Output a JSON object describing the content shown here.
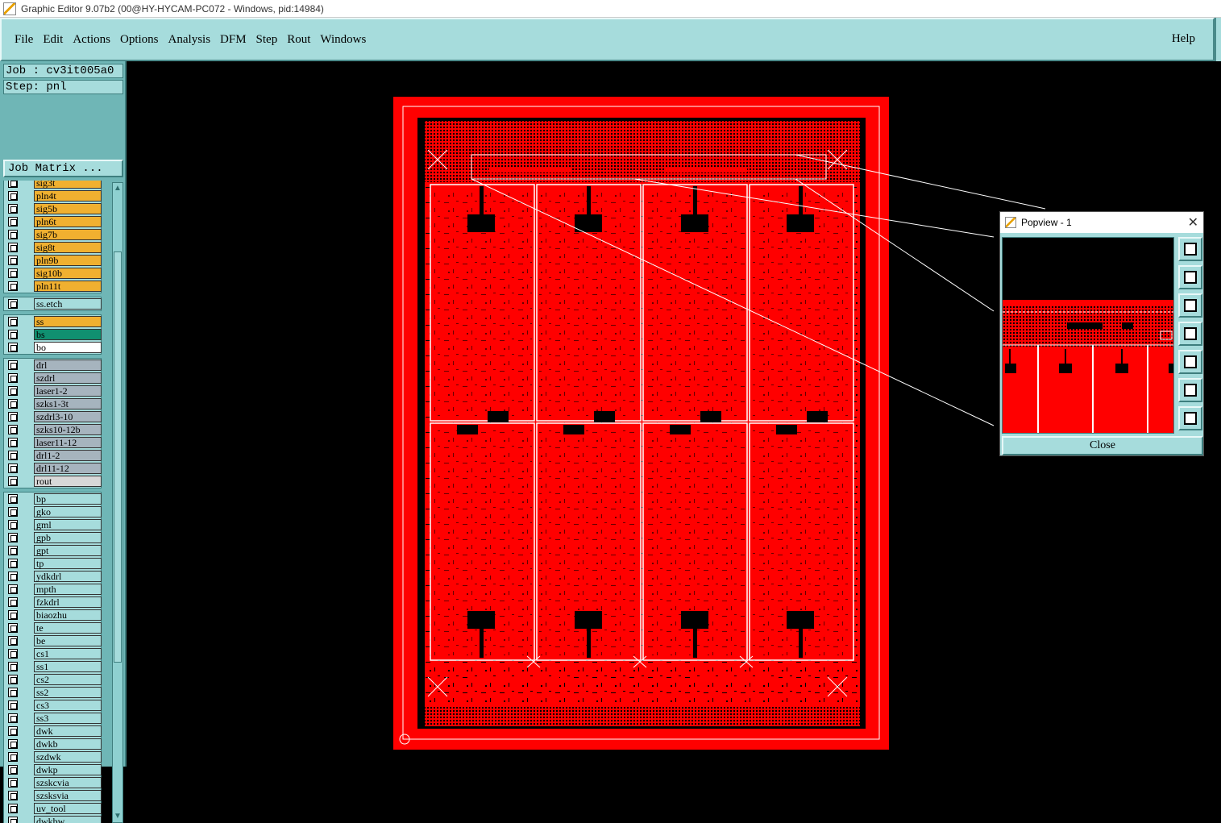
{
  "window": {
    "title": "Graphic Editor 9.07b2 (00@HY-HYCAM-PC072 - Windows, pid:14984)"
  },
  "menu": {
    "items": [
      "File",
      "Edit",
      "Actions",
      "Options",
      "Analysis",
      "DFM",
      "Step",
      "Rout",
      "Windows"
    ],
    "help": "Help"
  },
  "sidebar": {
    "job": "Job : cv3it005a0",
    "step": "Step: pnl",
    "job_matrix": "Job Matrix ...",
    "groups": [
      {
        "layers": [
          {
            "name": "sig3t",
            "color": "#f0b030"
          },
          {
            "name": "pln4t",
            "color": "#f0b030"
          },
          {
            "name": "sig5b",
            "color": "#f0b030"
          },
          {
            "name": "pln6t",
            "color": "#f0b030"
          },
          {
            "name": "sig7b",
            "color": "#f0b030"
          },
          {
            "name": "sig8t",
            "color": "#f0b030"
          },
          {
            "name": "pln9b",
            "color": "#f0b030"
          },
          {
            "name": "sig10b",
            "color": "#f0b030"
          },
          {
            "name": "pln11t",
            "color": "#f0b030"
          }
        ]
      },
      {
        "layers": [
          {
            "name": "ss.etch",
            "color": "#a6dcdc"
          }
        ]
      },
      {
        "layers": [
          {
            "name": "ss",
            "color": "#f0b030"
          },
          {
            "name": "bs",
            "color": "#109070"
          },
          {
            "name": "bo",
            "color": "#ffffff"
          }
        ]
      },
      {
        "layers": [
          {
            "name": "drl",
            "color": "#a6b4be"
          },
          {
            "name": "szdrl",
            "color": "#a6b4be"
          },
          {
            "name": "laser1-2",
            "color": "#a6b4be"
          },
          {
            "name": "szks1-3t",
            "color": "#a6b4be"
          },
          {
            "name": "szdrl3-10",
            "color": "#a6b4be"
          },
          {
            "name": "szks10-12b",
            "color": "#a6b4be"
          },
          {
            "name": "laser11-12",
            "color": "#a6b4be"
          },
          {
            "name": "drl1-2",
            "color": "#a6b4be"
          },
          {
            "name": "drl11-12",
            "color": "#a6b4be"
          },
          {
            "name": "rout",
            "color": "#d8d8d8"
          }
        ]
      },
      {
        "layers": [
          {
            "name": "bp",
            "color": "#a6dcdc"
          },
          {
            "name": "gko",
            "color": "#a6dcdc"
          },
          {
            "name": "gml",
            "color": "#a6dcdc"
          },
          {
            "name": "gpb",
            "color": "#a6dcdc"
          },
          {
            "name": "gpt",
            "color": "#a6dcdc"
          },
          {
            "name": "tp",
            "color": "#a6dcdc"
          },
          {
            "name": "ydkdrl",
            "color": "#a6dcdc"
          },
          {
            "name": "mpth",
            "color": "#a6dcdc"
          },
          {
            "name": "fzkdrl",
            "color": "#a6dcdc"
          },
          {
            "name": "biaozhu",
            "color": "#a6dcdc"
          },
          {
            "name": "te",
            "color": "#a6dcdc"
          },
          {
            "name": "be",
            "color": "#a6dcdc"
          },
          {
            "name": "cs1",
            "color": "#a6dcdc"
          },
          {
            "name": "ss1",
            "color": "#a6dcdc"
          },
          {
            "name": "cs2",
            "color": "#a6dcdc"
          },
          {
            "name": "ss2",
            "color": "#a6dcdc"
          },
          {
            "name": "cs3",
            "color": "#a6dcdc"
          },
          {
            "name": "ss3",
            "color": "#a6dcdc"
          },
          {
            "name": "dwk",
            "color": "#a6dcdc"
          },
          {
            "name": "dwkb",
            "color": "#a6dcdc"
          },
          {
            "name": "szdwk",
            "color": "#a6dcdc"
          },
          {
            "name": "dwkp",
            "color": "#a6dcdc"
          },
          {
            "name": "szskcvia",
            "color": "#a6dcdc"
          },
          {
            "name": "szsksvia",
            "color": "#a6dcdc"
          },
          {
            "name": "uv_tool",
            "color": "#a6dcdc"
          },
          {
            "name": "dwkbw",
            "color": "#a6dcdc"
          }
        ]
      }
    ]
  },
  "popview": {
    "title": "Popview - 1",
    "close_label": "Close",
    "tools": [
      "zoom-home-icon",
      "pan-up-icon",
      "pan-down-icon",
      "pan-left-icon",
      "pan-right-icon",
      "zoom-fit-icon",
      "zoom-center-icon"
    ]
  },
  "colors": {
    "accent": "#a6dcdc",
    "board": "#ff0000"
  }
}
